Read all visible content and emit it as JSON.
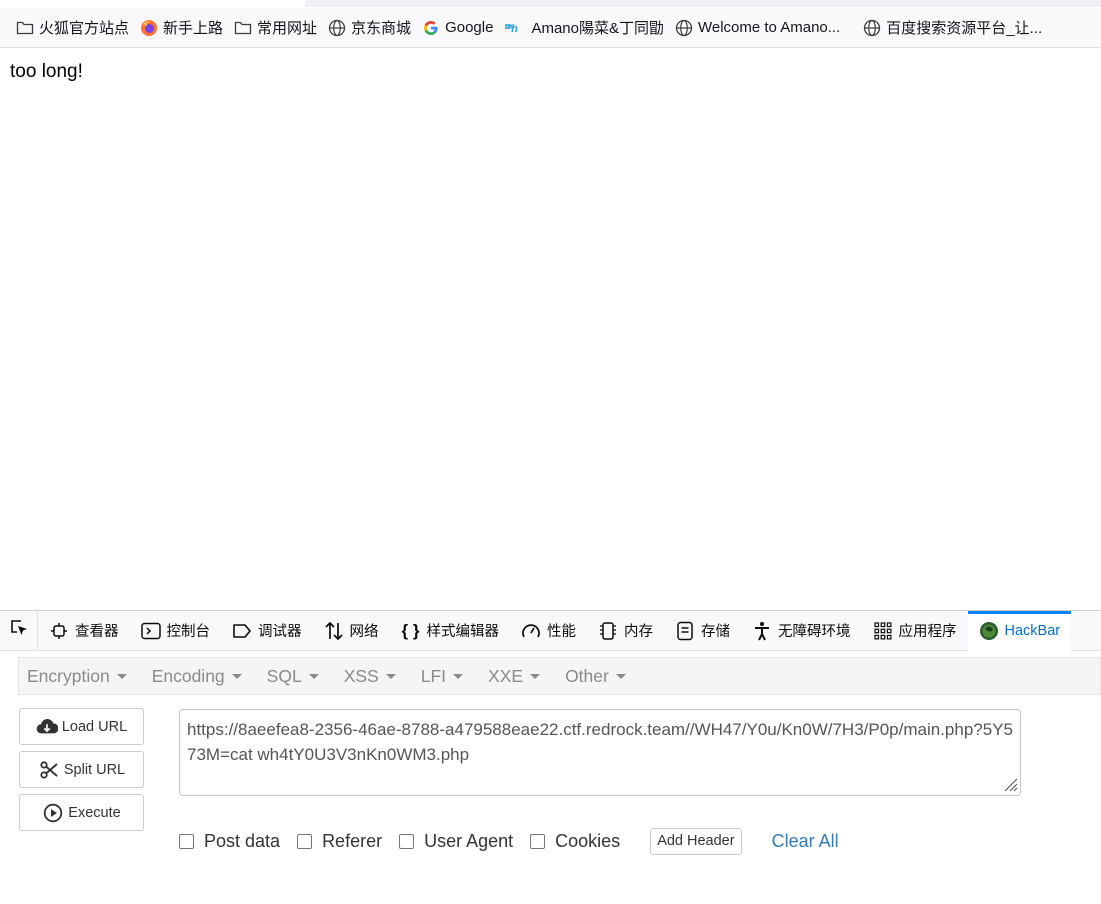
{
  "bookmarks": [
    {
      "label": "火狐官方站点",
      "icon": "folder-icon"
    },
    {
      "label": "新手上路",
      "icon": "firefox-icon"
    },
    {
      "label": "常用网址",
      "icon": "folder-icon"
    },
    {
      "label": "京东商城",
      "icon": "globe-icon"
    },
    {
      "label": "Google",
      "icon": "google-icon"
    },
    {
      "label": "Amano陽菜&丁同勖",
      "icon": "amano-icon"
    },
    {
      "label": "Welcome to Amano...",
      "icon": "globe-icon"
    },
    {
      "label": "百度搜索资源平台_让...",
      "icon": "globe-icon"
    }
  ],
  "page": {
    "text": "too long!"
  },
  "devtools": {
    "tabs": [
      {
        "label": "查看器",
        "icon": "inspector-icon"
      },
      {
        "label": "控制台",
        "icon": "console-icon"
      },
      {
        "label": "调试器",
        "icon": "debugger-icon"
      },
      {
        "label": "网络",
        "icon": "network-icon"
      },
      {
        "label": "样式编辑器",
        "icon": "braces-icon"
      },
      {
        "label": "性能",
        "icon": "gauge-icon"
      },
      {
        "label": "内存",
        "icon": "memory-icon"
      },
      {
        "label": "存储",
        "icon": "storage-icon"
      },
      {
        "label": "无障碍环境",
        "icon": "accessibility-icon"
      },
      {
        "label": "应用程序",
        "icon": "grid-icon"
      },
      {
        "label": "HackBar",
        "icon": "hackbar-icon",
        "active": true
      }
    ],
    "accent_color": "#0a84ff"
  },
  "hackbar": {
    "menus": [
      "Encryption",
      "Encoding",
      "SQL",
      "XSS",
      "LFI",
      "XXE",
      "Other"
    ],
    "buttons": {
      "load": "Load URL",
      "split": "Split URL",
      "execute": "Execute"
    },
    "url": "https://8aeefea8-2356-46ae-8788-a479588eae22.ctf.redrock.team//WH47/Y0u/Kn0W/7H3/P0p/main.php?5Y573M=cat wh4tY0U3V3nKn0WM3.php",
    "options": [
      "Post data",
      "Referer",
      "User Agent",
      "Cookies"
    ],
    "add_header": "Add Header",
    "clear_all": "Clear All",
    "link_color": "#337ab7"
  }
}
